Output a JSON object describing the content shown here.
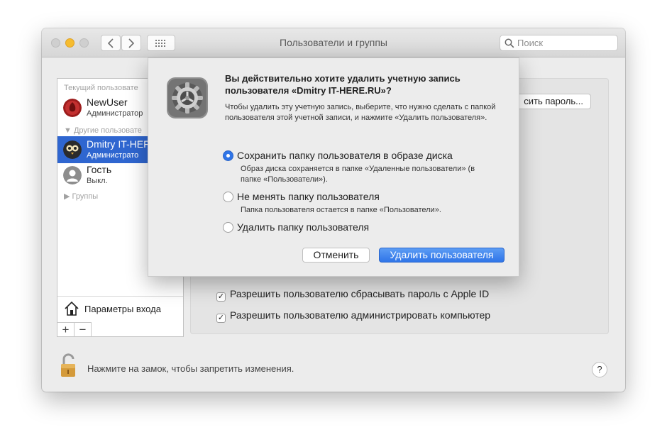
{
  "window": {
    "title": "Пользователи и группы",
    "search_placeholder": "Поиск"
  },
  "sidebar": {
    "current_users_header": "Текущий пользовате",
    "current_user": {
      "name": "NewUser",
      "role": "Администратор"
    },
    "other_users_header": "Другие пользовате",
    "other_users": [
      {
        "name": "Dmitry IT-HEF",
        "role": "Администрато"
      },
      {
        "name": "Гость",
        "role": "Выкл."
      }
    ],
    "groups_header": "Группы",
    "login_options_label": "Параметры входа",
    "add_symbol": "+",
    "remove_symbol": "−"
  },
  "main": {
    "change_password_button": "сить пароль...",
    "checkboxes": [
      {
        "label": "Разрешить пользователю сбрасывать пароль с Apple ID",
        "checked": true
      },
      {
        "label": "Разрешить пользователю администрировать компьютер",
        "checked": true
      }
    ]
  },
  "footer": {
    "lock_text": "Нажмите на замок, чтобы запретить изменения.",
    "help_symbol": "?"
  },
  "dialog": {
    "question": "Вы действительно хотите удалить учетную запись пользователя «Dmitry IT-HERE.RU»?",
    "explanation": "Чтобы удалить эту учетную запись, выберите, что нужно сделать с папкой пользователя этой учетной записи, и нажмите «Удалить пользователя».",
    "options": [
      {
        "label": "Сохранить папку пользователя в образе диска",
        "subtext": "Образ диска сохраняется в папке «Удаленные пользователи» (в папке «Пользователи»).",
        "selected": true
      },
      {
        "label": "Не менять папку пользователя",
        "subtext": "Папка пользователя остается в папке «Пользователи».",
        "selected": false
      },
      {
        "label": "Удалить папку пользователя",
        "subtext": "",
        "selected": false
      }
    ],
    "cancel_button": "Отменить",
    "delete_button": "Удалить пользователя"
  },
  "colors": {
    "accent": "#2f75e8",
    "selection": "#2f66d0"
  },
  "icons": {
    "back": "chevron-left-icon",
    "forward": "chevron-right-icon",
    "grid": "grid-icon",
    "search": "search-icon",
    "gear": "gear-icon",
    "lock": "lock-icon",
    "home": "home-icon"
  }
}
